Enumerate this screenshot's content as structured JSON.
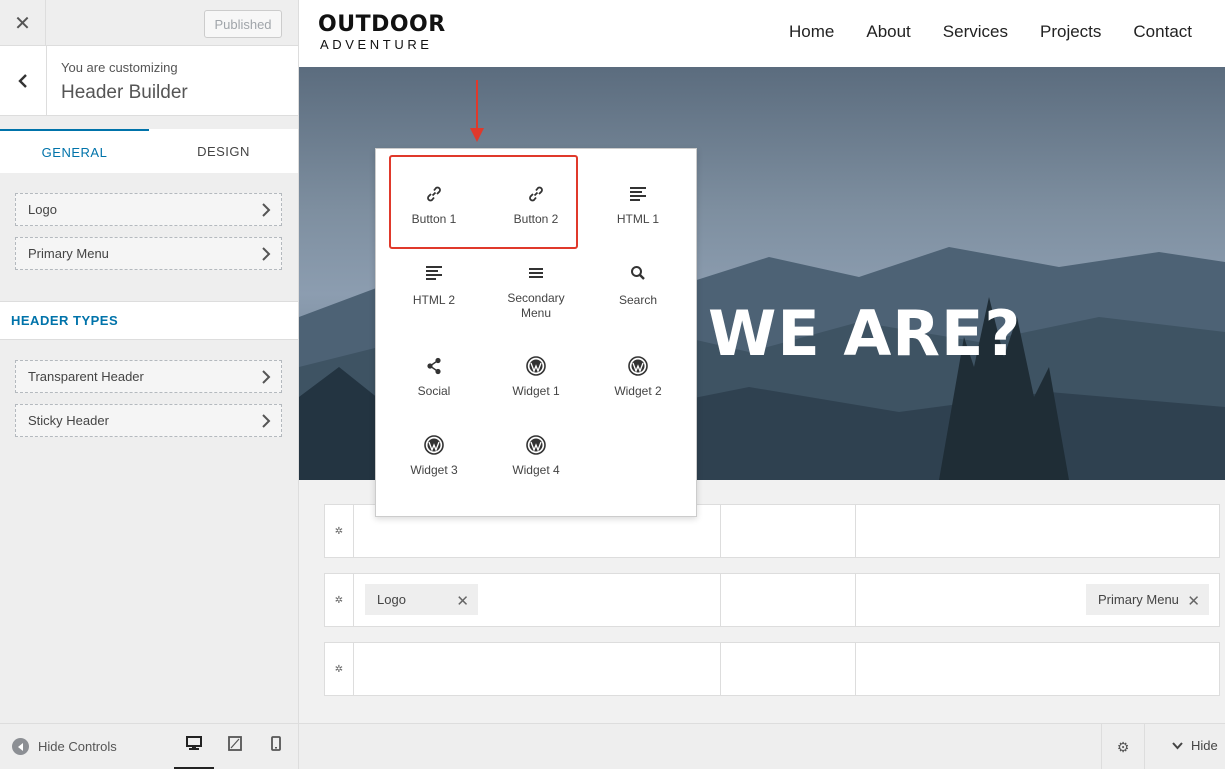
{
  "sidebar": {
    "published_label": "Published",
    "context_label": "You are customizing",
    "context_title": "Header Builder",
    "tabs": [
      {
        "label": "GENERAL"
      },
      {
        "label": "DESIGN"
      }
    ],
    "items": [
      {
        "label": "Logo"
      },
      {
        "label": "Primary Menu"
      }
    ],
    "section_title": "HEADER TYPES",
    "type_items": [
      {
        "label": "Transparent Header"
      },
      {
        "label": "Sticky Header"
      }
    ]
  },
  "footer": {
    "hide_controls": "Hide Controls",
    "hide": "Hide"
  },
  "site": {
    "logo_main": "OUTDOOR",
    "logo_sub": "ADVENTURE",
    "nav": [
      "Home",
      "About",
      "Services",
      "Projects",
      "Contact"
    ],
    "hero_title": "WE ARE?"
  },
  "popup": {
    "items": [
      {
        "label": "Button 1",
        "icon": "link-icon"
      },
      {
        "label": "Button 2",
        "icon": "link-icon"
      },
      {
        "label": "HTML 1",
        "icon": "html-icon"
      },
      {
        "label": "HTML 2",
        "icon": "html-icon"
      },
      {
        "label": "Secondary Menu",
        "icon": "menu-icon"
      },
      {
        "label": "Search",
        "icon": "search-icon"
      },
      {
        "label": "Social",
        "icon": "share-icon"
      },
      {
        "label": "Widget 1",
        "icon": "wordpress-icon"
      },
      {
        "label": "Widget 2",
        "icon": "wordpress-icon"
      },
      {
        "label": "Widget 3",
        "icon": "wordpress-icon"
      },
      {
        "label": "Widget 4",
        "icon": "wordpress-icon"
      }
    ]
  },
  "builder": {
    "chip_logo": "Logo",
    "chip_primary_menu": "Primary Menu"
  },
  "colors": {
    "accent": "#0073aa",
    "highlight": "#e0392b"
  }
}
